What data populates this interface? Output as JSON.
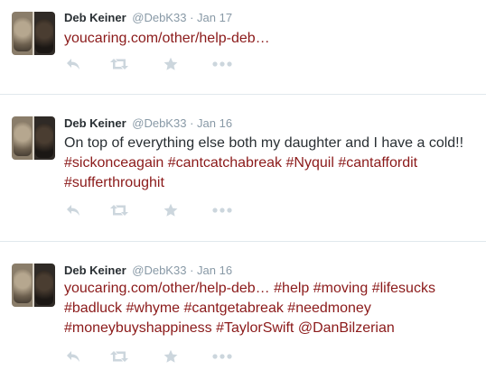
{
  "tweets": [
    {
      "name": "Deb Keiner",
      "handle": "@DebK33",
      "separator": "·",
      "time": "Jan 17",
      "segments": [
        {
          "text": "youcaring.com/other/help-deb…",
          "link": true
        }
      ]
    },
    {
      "name": "Deb Keiner",
      "handle": "@DebK33",
      "separator": "·",
      "time": "Jan 16",
      "segments": [
        {
          "text": "On top of everything else both my daughter and I have a cold!! ",
          "link": false
        },
        {
          "text": "#sickonceagain",
          "link": true
        },
        {
          "text": " ",
          "link": false
        },
        {
          "text": "#cantcatchabreak",
          "link": true
        },
        {
          "text": " ",
          "link": false
        },
        {
          "text": "#Nyquil",
          "link": true
        },
        {
          "text": " ",
          "link": false
        },
        {
          "text": "#cantaffordit",
          "link": true
        },
        {
          "text": " ",
          "link": false
        },
        {
          "text": "#sufferthroughit",
          "link": true
        }
      ]
    },
    {
      "name": "Deb Keiner",
      "handle": "@DebK33",
      "separator": "·",
      "time": "Jan 16",
      "segments": [
        {
          "text": "youcaring.com/other/help-deb…",
          "link": true
        },
        {
          "text": " ",
          "link": false
        },
        {
          "text": "#help",
          "link": true
        },
        {
          "text": " ",
          "link": false
        },
        {
          "text": "#moving",
          "link": true
        },
        {
          "text": " ",
          "link": false
        },
        {
          "text": "#lifesucks",
          "link": true
        },
        {
          "text": " ",
          "link": false
        },
        {
          "text": "#badluck",
          "link": true
        },
        {
          "text": " ",
          "link": false
        },
        {
          "text": "#whyme",
          "link": true
        },
        {
          "text": " ",
          "link": false
        },
        {
          "text": "#cantgetabreak",
          "link": true
        },
        {
          "text": " ",
          "link": false
        },
        {
          "text": "#needmoney",
          "link": true
        },
        {
          "text": " ",
          "link": false
        },
        {
          "text": "#moneybuyshappiness",
          "link": true
        },
        {
          "text": " ",
          "link": false
        },
        {
          "text": "#TaylorSwift",
          "link": true
        },
        {
          "text": "  ",
          "link": false
        },
        {
          "text": "@DanBilzerian",
          "link": true
        }
      ]
    }
  ],
  "action_icons": [
    "reply-icon",
    "retweet-icon",
    "favorite-icon",
    "more-icon"
  ],
  "colors": {
    "link": "#8b1a1a",
    "text": "#292f33",
    "muted": "#8899a6",
    "icon": "#ccd6dd",
    "divider": "#e1e8ed"
  }
}
